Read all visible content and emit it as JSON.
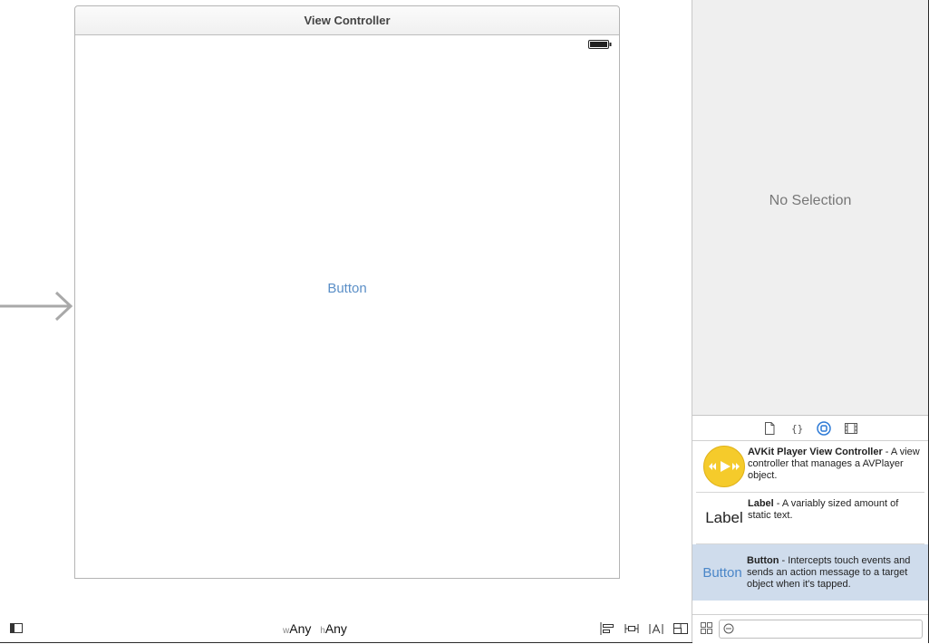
{
  "scene": {
    "title": "View Controller",
    "button_label": "Button"
  },
  "bottom_bar": {
    "width_prefix": "w",
    "width_value": "Any",
    "height_prefix": "h",
    "height_value": "Any"
  },
  "inspector": {
    "empty_text": "No Selection"
  },
  "library_tabs": [
    "file-template-icon",
    "code-snippet-icon",
    "object-library-icon",
    "media-library-icon"
  ],
  "library": {
    "items": [
      {
        "name": "AVKit Player View Controller",
        "description": " - A view controller that manages a AVPlayer object.",
        "thumb_icon": "avkit-play-icon"
      },
      {
        "name": "Label",
        "description": " - A variably sized amount of static text.",
        "thumb_text": "Label"
      },
      {
        "name": "Button",
        "description": " - Intercepts touch events and sends an action message to a target object when it's tapped.",
        "thumb_text": "Button"
      }
    ]
  },
  "colors": {
    "accent_blue": "#5b8fc7",
    "selection_bg": "#cfdcec",
    "inspector_bg": "#efefef",
    "avkit_yellow": "#f5cb2b"
  }
}
